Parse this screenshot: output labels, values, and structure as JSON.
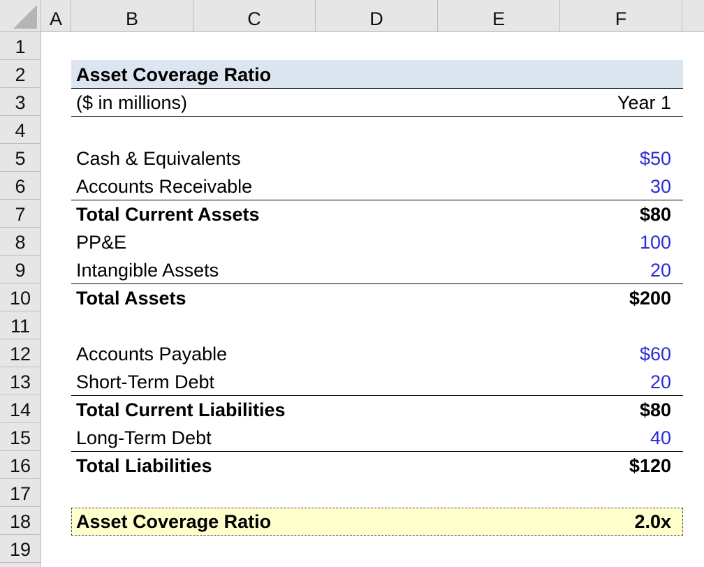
{
  "columns": [
    "A",
    "B",
    "C",
    "D",
    "E",
    "F"
  ],
  "rows": [
    "1",
    "2",
    "3",
    "4",
    "5",
    "6",
    "7",
    "8",
    "9",
    "10",
    "11",
    "12",
    "13",
    "14",
    "15",
    "16",
    "17",
    "18",
    "19"
  ],
  "table": {
    "title": "Asset Coverage Ratio",
    "units": "($ in millions)",
    "period": "Year 1",
    "lines": {
      "cash": {
        "label": "Cash & Equivalents",
        "value": "$50"
      },
      "ar": {
        "label": "Accounts Receivable",
        "value": "30"
      },
      "tca": {
        "label": "Total Current Assets",
        "value": "$80"
      },
      "ppe": {
        "label": "PP&E",
        "value": "100"
      },
      "intang": {
        "label": "Intangible Assets",
        "value": "20"
      },
      "ta": {
        "label": "Total Assets",
        "value": "$200"
      },
      "ap": {
        "label": "Accounts Payable",
        "value": "$60"
      },
      "std": {
        "label": "Short-Term Debt",
        "value": "20"
      },
      "tcl": {
        "label": "Total Current Liabilities",
        "value": "$80"
      },
      "ltd": {
        "label": "Long-Term Debt",
        "value": "40"
      },
      "tl": {
        "label": "Total Liabilities",
        "value": "$120"
      },
      "acr": {
        "label": "Asset Coverage Ratio",
        "value": "2.0x"
      }
    }
  },
  "colors": {
    "input_blue": "#2b2bd6",
    "title_fill": "#dce6f1",
    "highlight_fill": "#ffffcc",
    "header_gray": "#e6e6e6"
  }
}
